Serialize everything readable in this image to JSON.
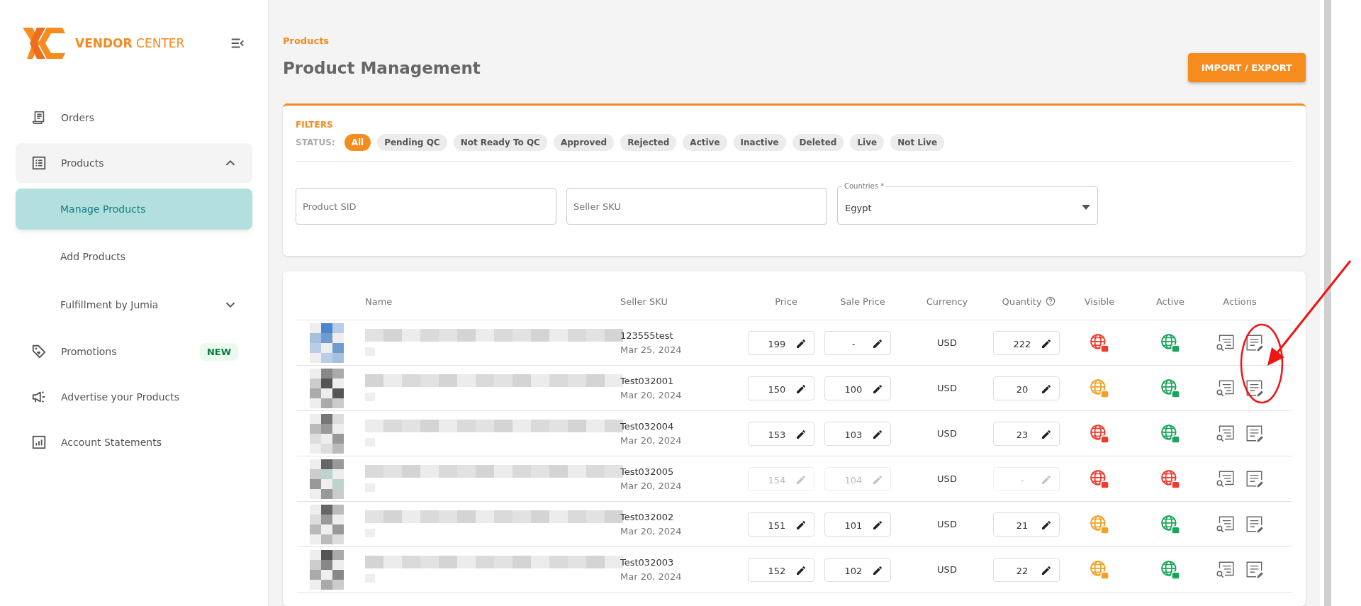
{
  "brand": {
    "name_bold": "VENDOR",
    "name_light": "CENTER"
  },
  "sidebar": {
    "items": [
      {
        "label": "Orders"
      },
      {
        "label": "Products",
        "expanded": true,
        "children": [
          {
            "label": "Manage Products",
            "selected": true
          },
          {
            "label": "Add Products",
            "selected": false
          },
          {
            "label": "Fulfillment by Jumia",
            "selected": false,
            "expanded": false
          }
        ]
      },
      {
        "label": "Promotions",
        "badge": "NEW"
      },
      {
        "label": "Advertise your Products"
      },
      {
        "label": "Account Statements"
      }
    ]
  },
  "breadcrumb": "Products",
  "title": "Product Management",
  "import_button": "IMPORT / EXPORT",
  "filters": {
    "title": "FILTERS",
    "status_label": "STATUS:",
    "statuses": [
      {
        "label": "All",
        "selected": true
      },
      {
        "label": "Pending QC",
        "selected": false
      },
      {
        "label": "Not Ready To QC",
        "selected": false
      },
      {
        "label": "Approved",
        "selected": false
      },
      {
        "label": "Rejected",
        "selected": false
      },
      {
        "label": "Active",
        "selected": false
      },
      {
        "label": "Inactive",
        "selected": false
      },
      {
        "label": "Deleted",
        "selected": false
      },
      {
        "label": "Live",
        "selected": false
      },
      {
        "label": "Not Live",
        "selected": false
      }
    ],
    "product_sid": {
      "placeholder": "Product SID"
    },
    "seller_sku": {
      "placeholder": "Seller SKU"
    },
    "countries": {
      "label": "Countries *",
      "value": "Egypt"
    }
  },
  "table": {
    "columns": [
      "Name",
      "Seller SKU",
      "Price",
      "Sale Price",
      "Currency",
      "Quantity",
      "Visible",
      "Active",
      "Actions"
    ],
    "rows": [
      {
        "sku": "123555test",
        "date": "Mar 25, 2024",
        "price": "199",
        "sale_price": "-",
        "currency": "USD",
        "quantity": "222",
        "disabled": false,
        "visible": {
          "color": "#f03a2e"
        },
        "active": {
          "color": "#1aa55a"
        }
      },
      {
        "sku": "Test032001",
        "date": "Mar 20, 2024",
        "price": "150",
        "sale_price": "100",
        "currency": "USD",
        "quantity": "20",
        "disabled": false,
        "visible": {
          "color": "#f5a020"
        },
        "active": {
          "color": "#1aa55a"
        }
      },
      {
        "sku": "Test032004",
        "date": "Mar 20, 2024",
        "price": "153",
        "sale_price": "103",
        "currency": "USD",
        "quantity": "23",
        "disabled": false,
        "visible": {
          "color": "#f03a2e"
        },
        "active": {
          "color": "#1aa55a"
        }
      },
      {
        "sku": "Test032005",
        "date": "Mar 20, 2024",
        "price": "154",
        "sale_price": "104",
        "currency": "USD",
        "quantity": "-",
        "disabled": true,
        "visible": {
          "color": "#f03a2e"
        },
        "active": {
          "color": "#f03a2e"
        }
      },
      {
        "sku": "Test032002",
        "date": "Mar 20, 2024",
        "price": "151",
        "sale_price": "101",
        "currency": "USD",
        "quantity": "21",
        "disabled": false,
        "visible": {
          "color": "#f5a020"
        },
        "active": {
          "color": "#1aa55a"
        }
      },
      {
        "sku": "Test032003",
        "date": "Mar 20, 2024",
        "price": "152",
        "sale_price": "102",
        "currency": "USD",
        "quantity": "22",
        "disabled": false,
        "visible": {
          "color": "#f5a020"
        },
        "active": {
          "color": "#1aa55a"
        }
      }
    ]
  }
}
